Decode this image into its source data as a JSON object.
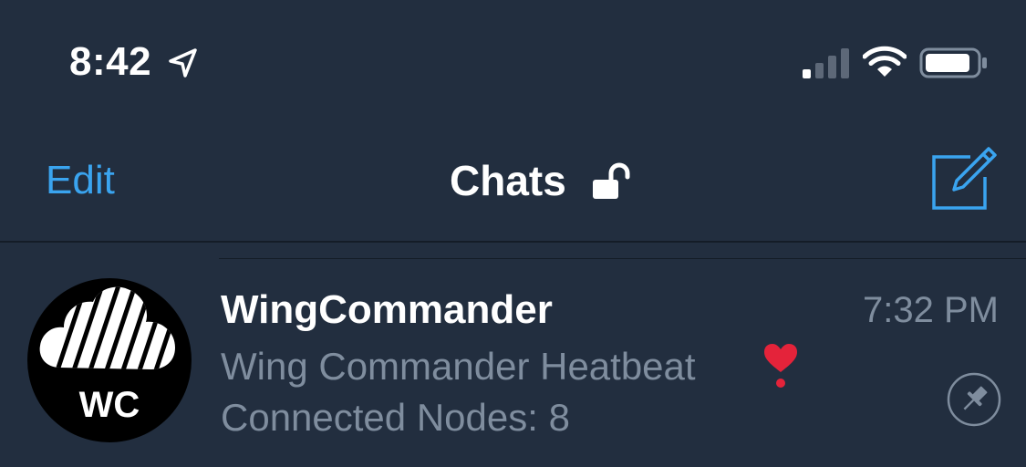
{
  "status_bar": {
    "time": "8:42",
    "location_icon": "location-arrow-icon",
    "signal_icon": "cellular-signal-icon",
    "wifi_icon": "wifi-icon",
    "battery_icon": "battery-icon"
  },
  "nav": {
    "edit_label": "Edit",
    "title": "Chats",
    "lock_icon": "unlocked-padlock-icon",
    "compose_icon": "compose-icon"
  },
  "chats": [
    {
      "avatar_text": "WC",
      "name": "WingCommander",
      "time": "7:32 PM",
      "preview_line1": "Wing Commander Heatbeat",
      "preview_emoji": "❣️",
      "preview_line2": "Connected Nodes: 8",
      "pinned": true,
      "pin_icon": "pin-icon"
    }
  ],
  "colors": {
    "background": "#222e3f",
    "accent": "#3aa4ef",
    "secondary_text": "#7f8d9e",
    "primary_text": "#ffffff",
    "divider": "#141c27"
  }
}
